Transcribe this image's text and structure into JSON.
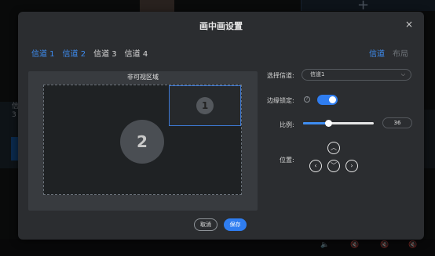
{
  "dialog": {
    "title": "画中画设置",
    "close_icon": "×"
  },
  "channel_tabs": [
    {
      "label": "信道 1",
      "active": true
    },
    {
      "label": "信道 2",
      "active": true
    },
    {
      "label": "信道 3",
      "active": false
    },
    {
      "label": "信道 4",
      "active": false
    }
  ],
  "mode_tabs": [
    {
      "label": "信道",
      "active": true
    },
    {
      "label": "布局",
      "active": false
    }
  ],
  "preview": {
    "label": "非可视区域",
    "main_number": "2",
    "pip_number": "1"
  },
  "settings": {
    "channel_select_label": "选择信道:",
    "channel_select_value": "信道1",
    "edge_lock_label": "边缘锁定:",
    "edge_lock_help_icon": "?",
    "edge_lock_on": true,
    "scale_label": "比例:",
    "scale_value": "36",
    "scale_fraction": 0.36,
    "position_label": "位置:"
  },
  "buttons": {
    "cancel": "取消",
    "save": "保存"
  },
  "colors": {
    "accent": "#2f7df0",
    "dialog_bg": "#2b2d30"
  }
}
